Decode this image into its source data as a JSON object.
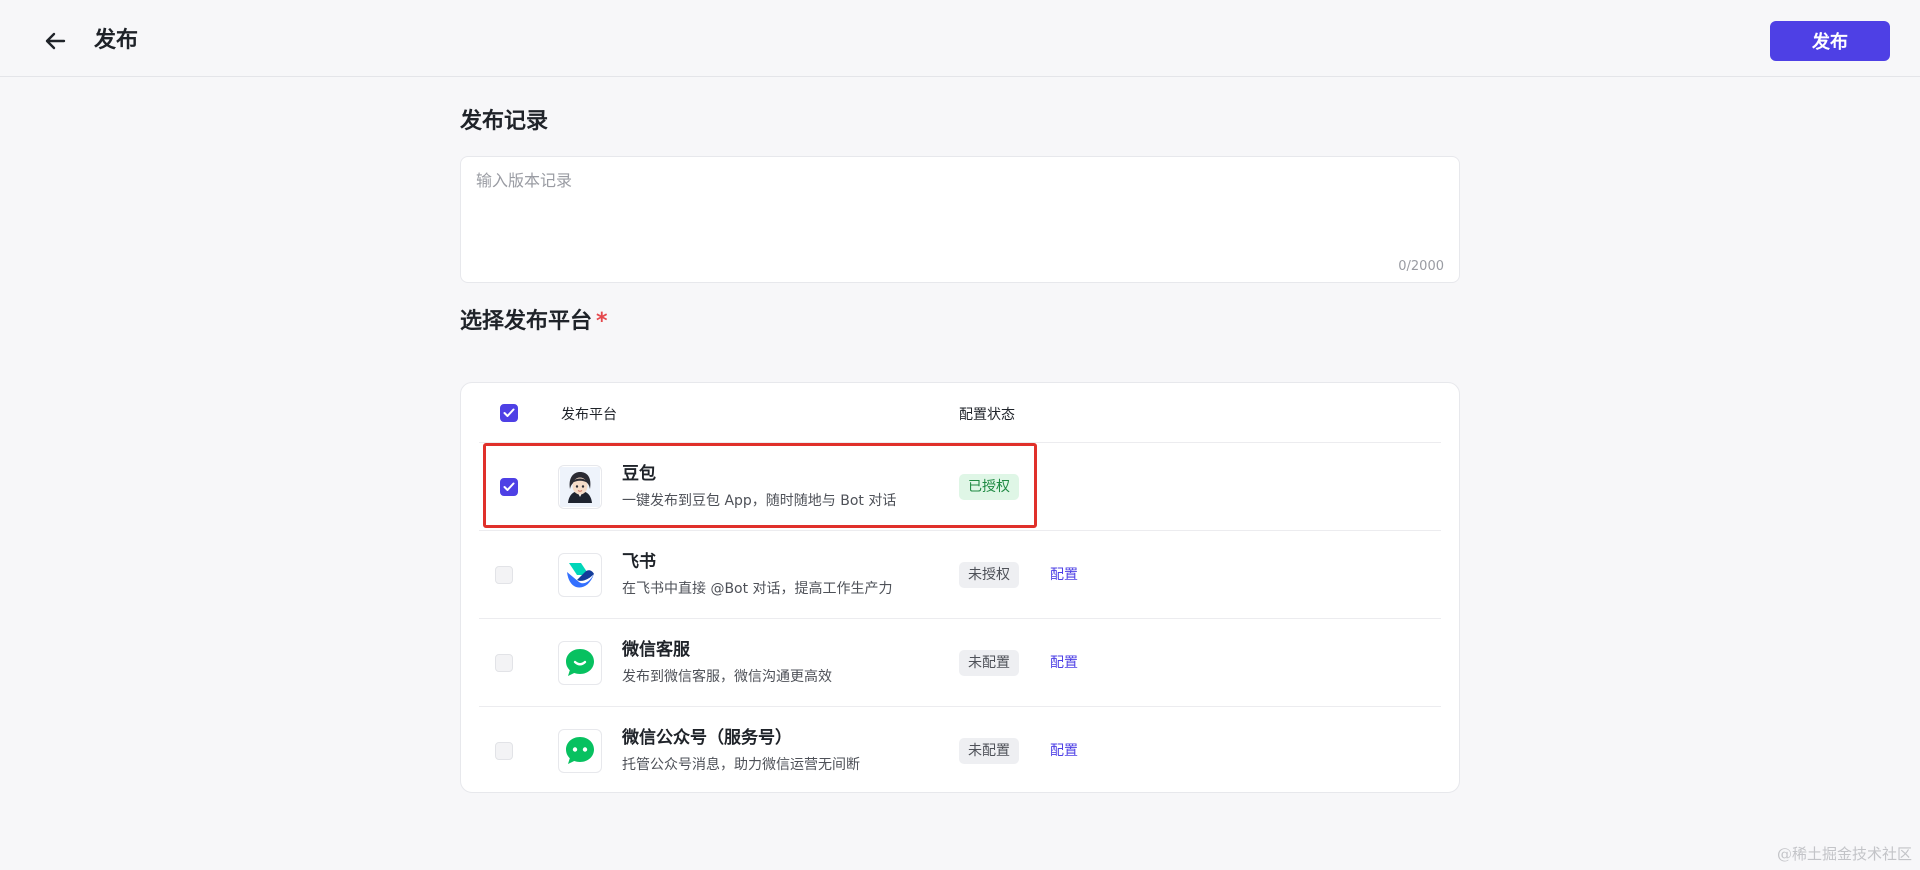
{
  "header": {
    "title": "发布",
    "publish_label": "发布"
  },
  "record": {
    "title": "发布记录",
    "placeholder": "输入版本记录",
    "value": "",
    "count": "0/2000"
  },
  "platforms": {
    "title": "选择发布平台",
    "required_mark": "*",
    "columns": {
      "platform": "发布平台",
      "status": "配置状态"
    },
    "select_all_checked": true,
    "items": [
      {
        "name": "豆包",
        "desc": "一键发布到豆包 App，随时随地与 Bot 对话",
        "status": "已授权",
        "checked": true,
        "icon": "doubao-avatar-icon"
      },
      {
        "name": "飞书",
        "desc": "在飞书中直接 @Bot 对话，提高工作生产力",
        "status": "未授权",
        "config": "配置",
        "checked": false,
        "icon": "feishu-logo-icon"
      },
      {
        "name": "微信客服",
        "desc": "发布到微信客服，微信沟通更高效",
        "status": "未配置",
        "config": "配置",
        "checked": false,
        "icon": "wechat-service-icon"
      },
      {
        "name": "微信公众号（服务号）",
        "desc": "托管公众号消息，助力微信运营无间断",
        "status": "未配置",
        "config": "配置",
        "checked": false,
        "icon": "wechat-official-icon"
      }
    ]
  },
  "colors": {
    "accent": "#4e40e5",
    "highlight": "#e0302a",
    "wechat_green": "#07c160"
  },
  "watermark": "@稀土掘金技术社区"
}
